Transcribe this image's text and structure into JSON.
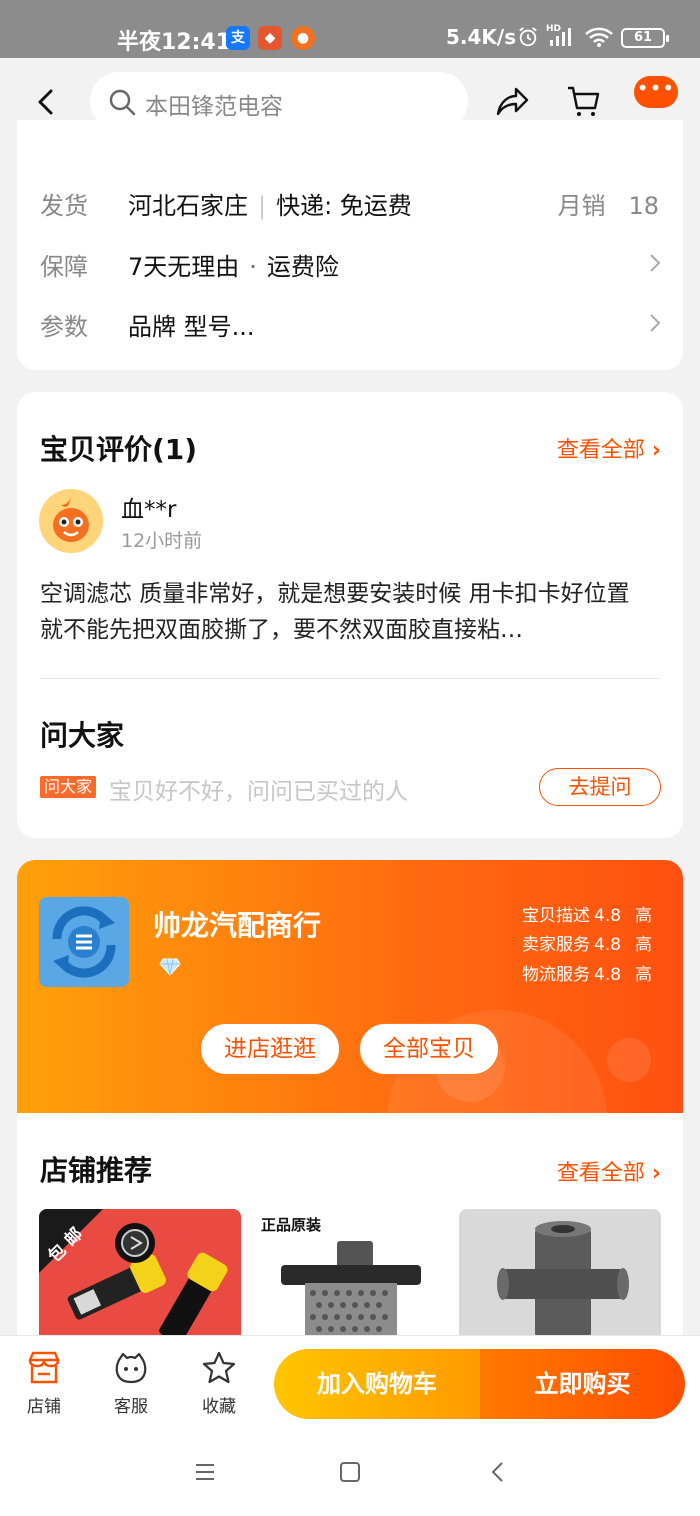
{
  "status_bar": {
    "time": "半夜12:41",
    "net_speed": "5.4K/s",
    "battery": "61",
    "hd_label": "HD"
  },
  "header": {
    "search_placeholder": "本田锋范电容"
  },
  "info_rows": {
    "ship_label": "发货",
    "ship_origin": "河北石家庄",
    "ship_express": "快递: 免运费",
    "monthly_sales_label": "月销",
    "monthly_sales_value": "18",
    "guarantee_label": "保障",
    "guarantee_item1": "7天无理由",
    "guarantee_item2": "运费险",
    "params_label": "参数",
    "params_value": "品牌 型号..."
  },
  "reviews": {
    "title": "宝贝评价(1)",
    "view_all": "查看全部",
    "user": "血**r",
    "time": "12小时前",
    "text": "空调滤芯 质量非常好，就是想要安装时候 用卡扣卡好位置 就不能先把双面胶撕了，要不然双面胶直接粘…"
  },
  "ask": {
    "title": "问大家",
    "badge": "问大家",
    "placeholder": "宝贝好不好，问问已买过的人",
    "button": "去提问"
  },
  "shop": {
    "name": "帅龙汽配商行",
    "scores": [
      {
        "label": "宝贝描述",
        "value": "4.8",
        "grade": "高"
      },
      {
        "label": "卖家服务",
        "value": "4.8",
        "grade": "高"
      },
      {
        "label": "物流服务",
        "value": "4.8",
        "grade": "高"
      }
    ],
    "enter_button": "进店逛逛",
    "all_button": "全部宝贝"
  },
  "recommend": {
    "title": "店铺推荐",
    "view_all": "查看全部",
    "badge_baoyou": "包邮",
    "badge_genuine": "正品原装"
  },
  "bottom_bar": {
    "shop": "店铺",
    "service": "客服",
    "favorite": "收藏",
    "add_cart": "加入购物车",
    "buy_now": "立即购买"
  },
  "colors": {
    "accent": "#ff5000",
    "shop_gradient_start": "#ffa10a",
    "shop_gradient_end": "#ff5010",
    "cart_button": "#ffb300",
    "buy_button": "#ff5a00"
  }
}
